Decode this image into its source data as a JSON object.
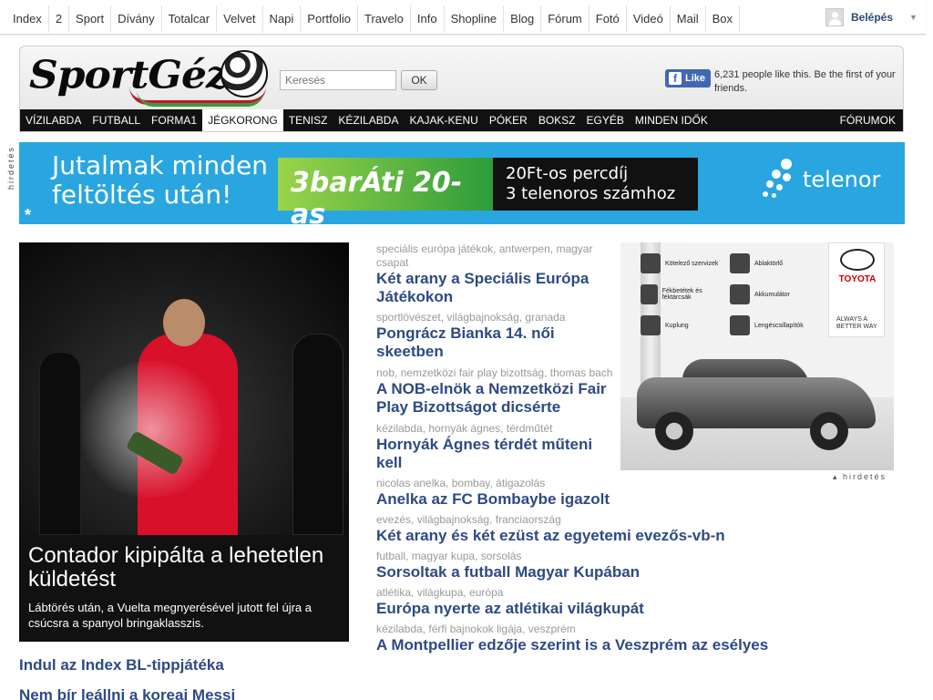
{
  "topnav": [
    "Index",
    "2",
    "Sport",
    "Dívány",
    "Totalcar",
    "Velvet",
    "Napi",
    "Portfolio",
    "Travelo",
    "Info",
    "Shopline",
    "Blog",
    "Fórum",
    "Fotó",
    "Videó",
    "Mail",
    "Box"
  ],
  "login": {
    "label": "Belépés"
  },
  "header": {
    "logo_text": "SportGéza",
    "search_placeholder": "Keresés",
    "search_button": "OK",
    "fb_like": "Like",
    "fb_text": "6,231 people like this. Be the first of your friends."
  },
  "catnav": {
    "items": [
      "VÍZILABDA",
      "FUTBALL",
      "FORMA1",
      "JÉGKORONG",
      "TENISZ",
      "KÉZILABDA",
      "KAJAK-KENU",
      "PÓKER",
      "BOKSZ",
      "EGYÉB",
      "MINDEN IDŐK"
    ],
    "active": "JÉGKORONG",
    "right": "FÓRUMOK"
  },
  "banner": {
    "side_label": "hirdetés",
    "line1": "Jutalmak minden",
    "line2": "feltöltés után!",
    "promo": "3barÁti 20-as",
    "offer1": "20Ft-os percdíj",
    "offer2": "3 telenoros számhoz",
    "brand": "telenor",
    "star": "*"
  },
  "lead": {
    "title": "Contador kipipálta a lehetetlen küldetést",
    "desc": "Láb­törés után, a Vuelta megnyerésével jutott fel újra a csúcsra a spanyol bringaklasszis."
  },
  "below_lead": [
    "Indul az Index BL-tippjátéka",
    "Nem bír leállni a koreai Messi"
  ],
  "news": [
    {
      "tags": "speciális európa játékok, antwerpen, magyar csapat",
      "title": "Két arany a Speciális Európa Játékokon"
    },
    {
      "tags": "sportlövészet, világbajnokság, granada",
      "title": "Pongrácz Bianka 14. női skeetben"
    },
    {
      "tags": "nob, nemzetközi fair play bizottság, thomas bach",
      "title": "A NOB-elnök a Nemzetközi Fair Play Bizottságot dicsérte"
    },
    {
      "tags": "kézilabda, hornyák ágnes, térdműtét",
      "title": "Hornyák Ágnes térdét műteni kell"
    },
    {
      "tags": "nicolas anelka, bombay, átigazolás",
      "title": "Anelka az FC Bombaybe igazolt"
    },
    {
      "tags": "evezés, világbajnokság, franciaország",
      "title": "Két arany és két ezüst az egyetemi evezős-vb-n"
    },
    {
      "tags": "futball, magyar kupa, sorsolás",
      "title": "Sorsoltak a futball Magyar Kupában"
    },
    {
      "tags": "atlétika, világkupa, európa",
      "title": "Európa nyerte az atlétikai világkupát"
    },
    {
      "tags": "kézilabda, férfi bajnokok ligája, veszprém",
      "title": "A Montpellier edzője szerint is a Veszprém az esélyes"
    }
  ],
  "toyota_ad": {
    "items": [
      "Kötelező szervizek",
      "Ablaktörlő",
      "Fékbetétek és féktárcsák",
      "Akkumulátor",
      "Kuplung",
      "Lengéscsillapítók"
    ],
    "brand": "TOYOTA",
    "slogan": "ALWAYS A BETTER WAY",
    "label": "hirdetés"
  },
  "colors": {
    "headline": "#2d4a83",
    "tags": "#999999",
    "banner": "#29a6e0",
    "nav": "#111111"
  }
}
